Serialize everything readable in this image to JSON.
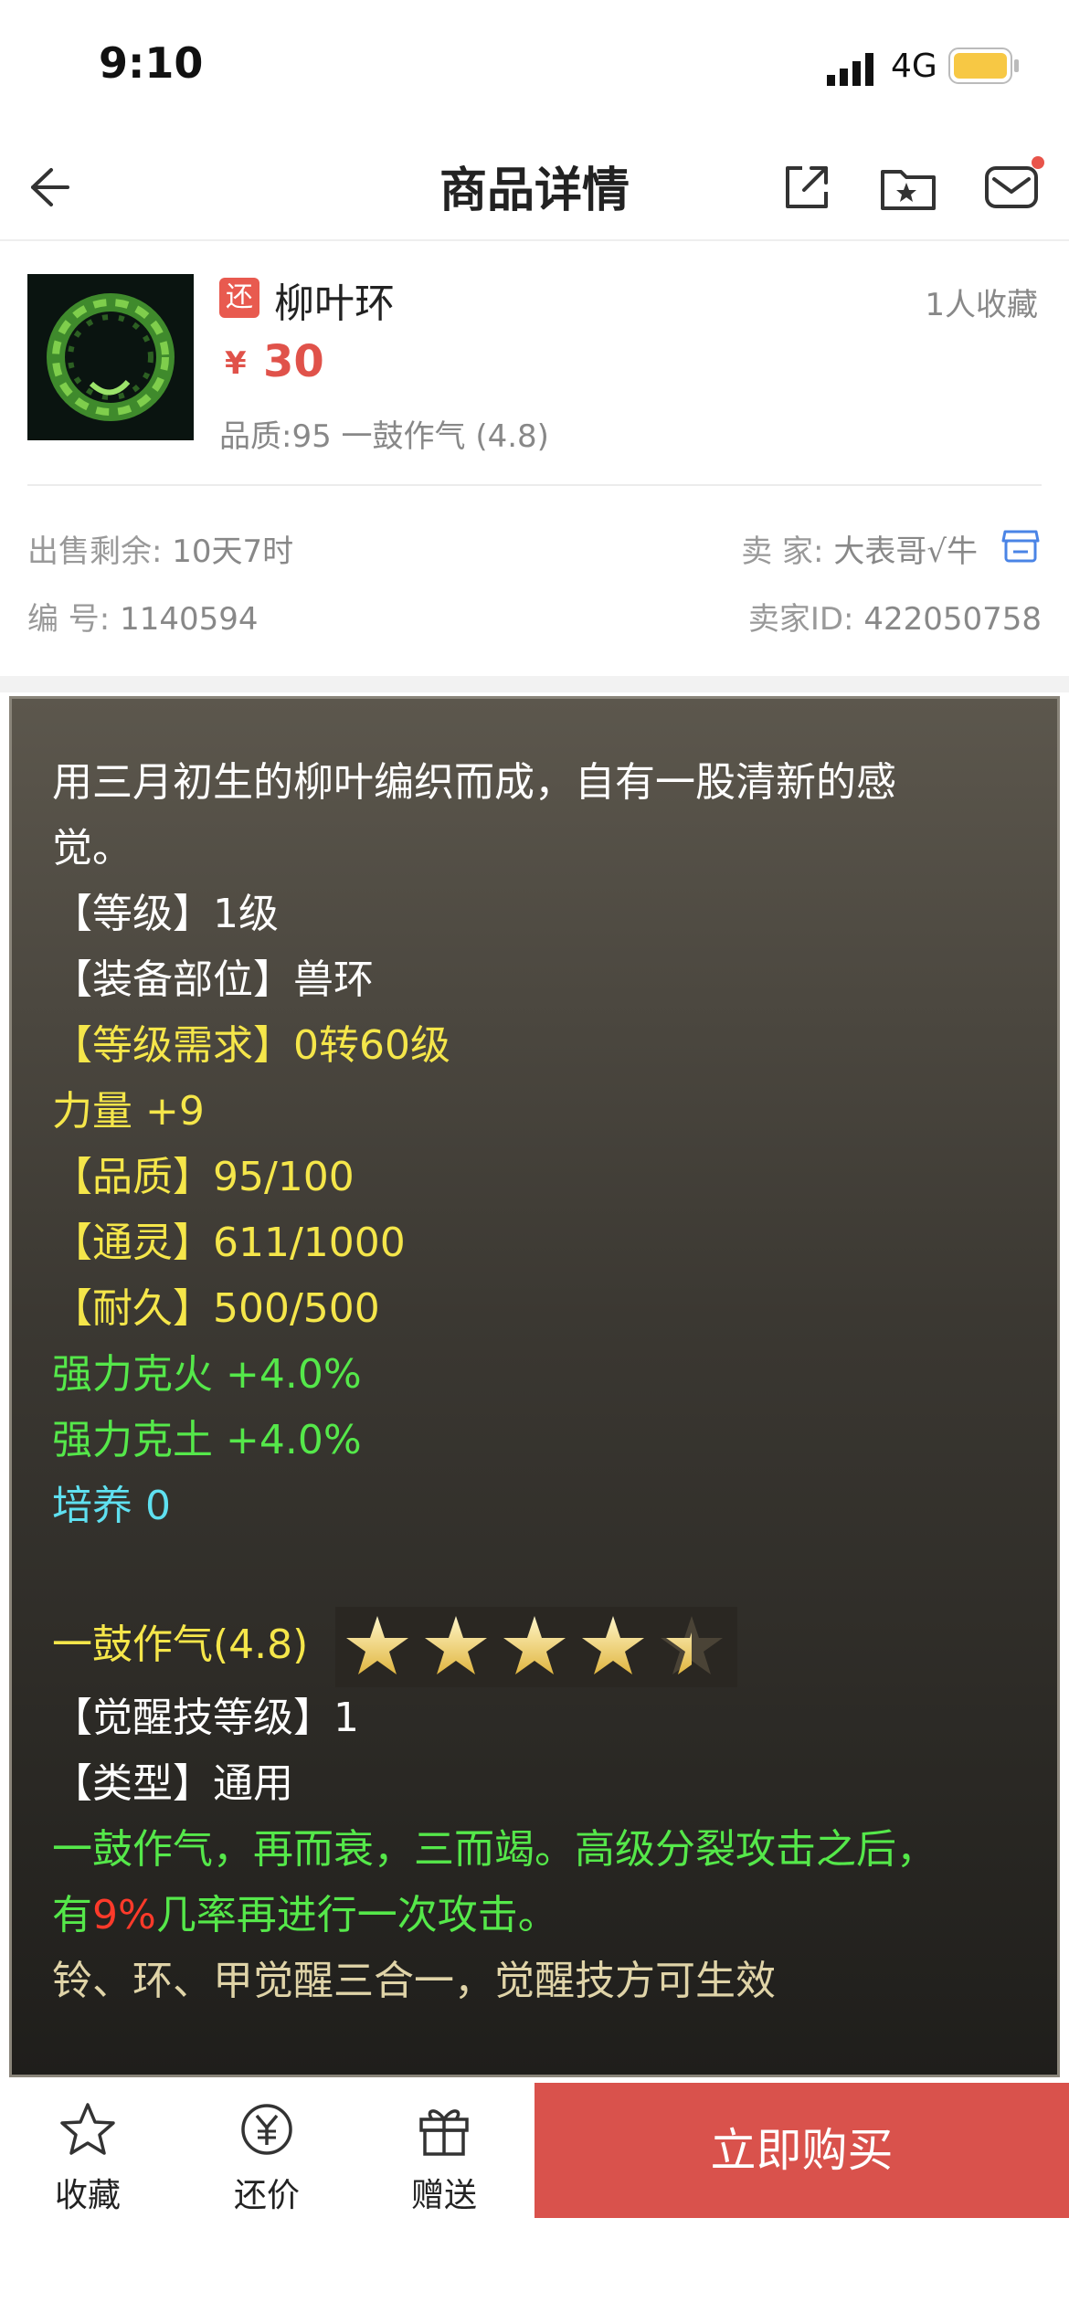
{
  "status": {
    "time": "9:10",
    "network": "4G"
  },
  "nav": {
    "title": "商品详情"
  },
  "product": {
    "badge": "还",
    "name": "柳叶环",
    "favorites": "1人收藏",
    "price_symbol": "¥",
    "price": "30",
    "quality": "品质:95 一鼓作气 (4.8)"
  },
  "info": {
    "remaining_label": "出售剩余:",
    "remaining_value": "10天7时",
    "seller_label": "卖 家:",
    "seller_value": "大表哥√牛",
    "number_label": "编 号:",
    "number_value": "1140594",
    "seller_id_label": "卖家ID:",
    "seller_id_value": "422050758"
  },
  "details": {
    "desc1": "用三月初生的柳叶编织而成，自有一股清新的感",
    "desc2": "觉。",
    "level": "【等级】1级",
    "slot": "【装备部位】兽环",
    "req": "【等级需求】0转60级",
    "str": "力量 +9",
    "quality": "【品质】95/100",
    "spirit": "【通灵】611/1000",
    "durability": "【耐久】500/500",
    "fire": "强力克火 +4.0%",
    "earth": "强力克土 +4.0%",
    "train": "培养 0",
    "awaken_name": "一鼓作气(4.8)",
    "awaken_rating": 4.8,
    "awaken_level": "【觉醒技等级】1",
    "type": "【类型】通用",
    "skill_a": "一鼓作气，再而衰，三而竭。高级分裂攻击之后，",
    "skill_b1": "有",
    "skill_b2": "9%",
    "skill_b3": "几率再进行一次攻击。",
    "note": "铃、环、甲觉醒三合一，觉醒技方可生效"
  },
  "tabbar": {
    "favorite": "收藏",
    "bargain": "还价",
    "gift": "赠送",
    "buy": "立即购买"
  }
}
